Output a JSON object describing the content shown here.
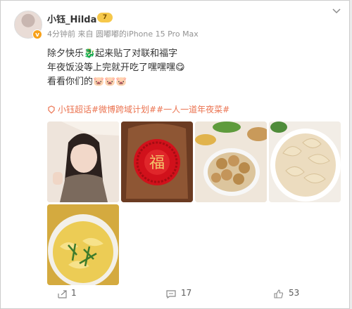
{
  "user": {
    "name": "小钰_Hilda",
    "level": "7",
    "verified": "v"
  },
  "meta": {
    "time": "4分钟前",
    "source_prefix": "来自",
    "source": "圆嘟嘟的iPhone 15 Pro Max"
  },
  "post": {
    "lines": [
      "除夕快乐🐉起来贴了对联和福字",
      "年夜饭没等上完就开吃了嘿嘿嘿😋",
      "看看你们的🐷🐷🐷"
    ],
    "tags": "小钰超话#微博跨域计划##一人一道年夜菜#"
  },
  "actions": {
    "share": "1",
    "comments": "17",
    "likes": "53"
  },
  "colors": {
    "tag": "#eb7350",
    "meta": "#939393",
    "badge": "#f6c84a"
  }
}
